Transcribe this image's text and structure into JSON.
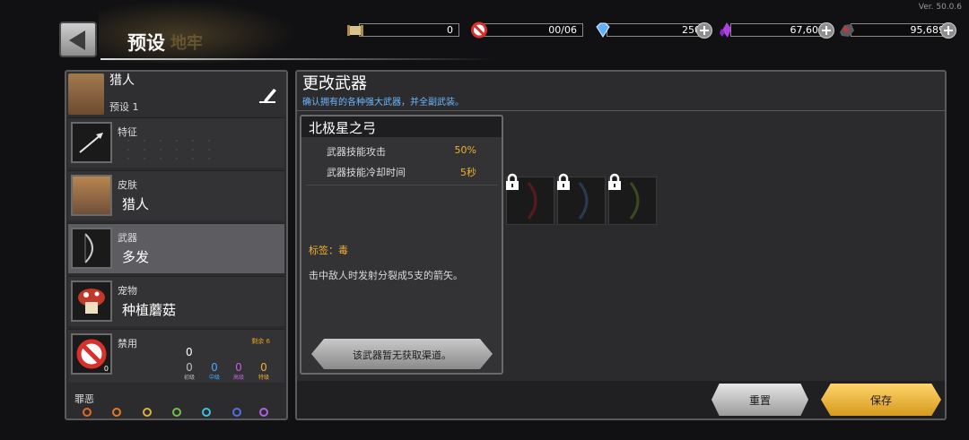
{
  "version": "Ver. 50.0.6",
  "header": {
    "title": "预设",
    "ghost": "地牢"
  },
  "resources": [
    {
      "name": "scroll",
      "icon": "scroll-icon",
      "value": "0"
    },
    {
      "name": "banned",
      "icon": "ban-icon",
      "value": "00/06"
    },
    {
      "name": "gems",
      "icon": "diamond-icon",
      "value": "250"
    },
    {
      "name": "crystals",
      "icon": "crystal-icon",
      "value": "67,600"
    },
    {
      "name": "ore",
      "icon": "ore-icon",
      "value": "95,689"
    }
  ],
  "hero": {
    "name": "猎人",
    "preset": "预设 1"
  },
  "slots": {
    "trait": {
      "category": "特征"
    },
    "skin": {
      "category": "皮肤",
      "value": "猎人"
    },
    "weapon": {
      "category": "武器",
      "value": "多发"
    },
    "pet": {
      "category": "宠物",
      "value": "种植蘑菇"
    },
    "ban": {
      "category": "禁用",
      "remaining": "剩余 6",
      "badge": "0",
      "total": "0",
      "tiers": [
        {
          "count": "0",
          "label": "初级",
          "color": "#bdbdbd"
        },
        {
          "count": "0",
          "label": "中级",
          "color": "#4aa8ff"
        },
        {
          "count": "0",
          "label": "高级",
          "color": "#c060e0"
        },
        {
          "count": "0",
          "label": "特级",
          "color": "#f0b030"
        }
      ]
    }
  },
  "sins": {
    "label": "罪恶",
    "colors": [
      "#e06a2a",
      "#e07a2a",
      "#e0b030",
      "#70c050",
      "#40c0e0",
      "#5070e0",
      "#b060e0"
    ]
  },
  "panel": {
    "title": "更改武器",
    "subtitle": "确认拥有的各种强大武器，并全副武装。"
  },
  "weapon_detail": {
    "name": "北极星之弓",
    "stats": [
      {
        "label": "武器技能攻击",
        "value": "50%"
      },
      {
        "label": "武器技能冷却时间",
        "value": "5秒"
      }
    ],
    "tag": "标签：毒",
    "description": "击中敌人时发射分裂成5支的箭矢。",
    "unavailable": "该武器暂无获取渠道。"
  },
  "buttons": {
    "reset": "重置",
    "save": "保存"
  }
}
